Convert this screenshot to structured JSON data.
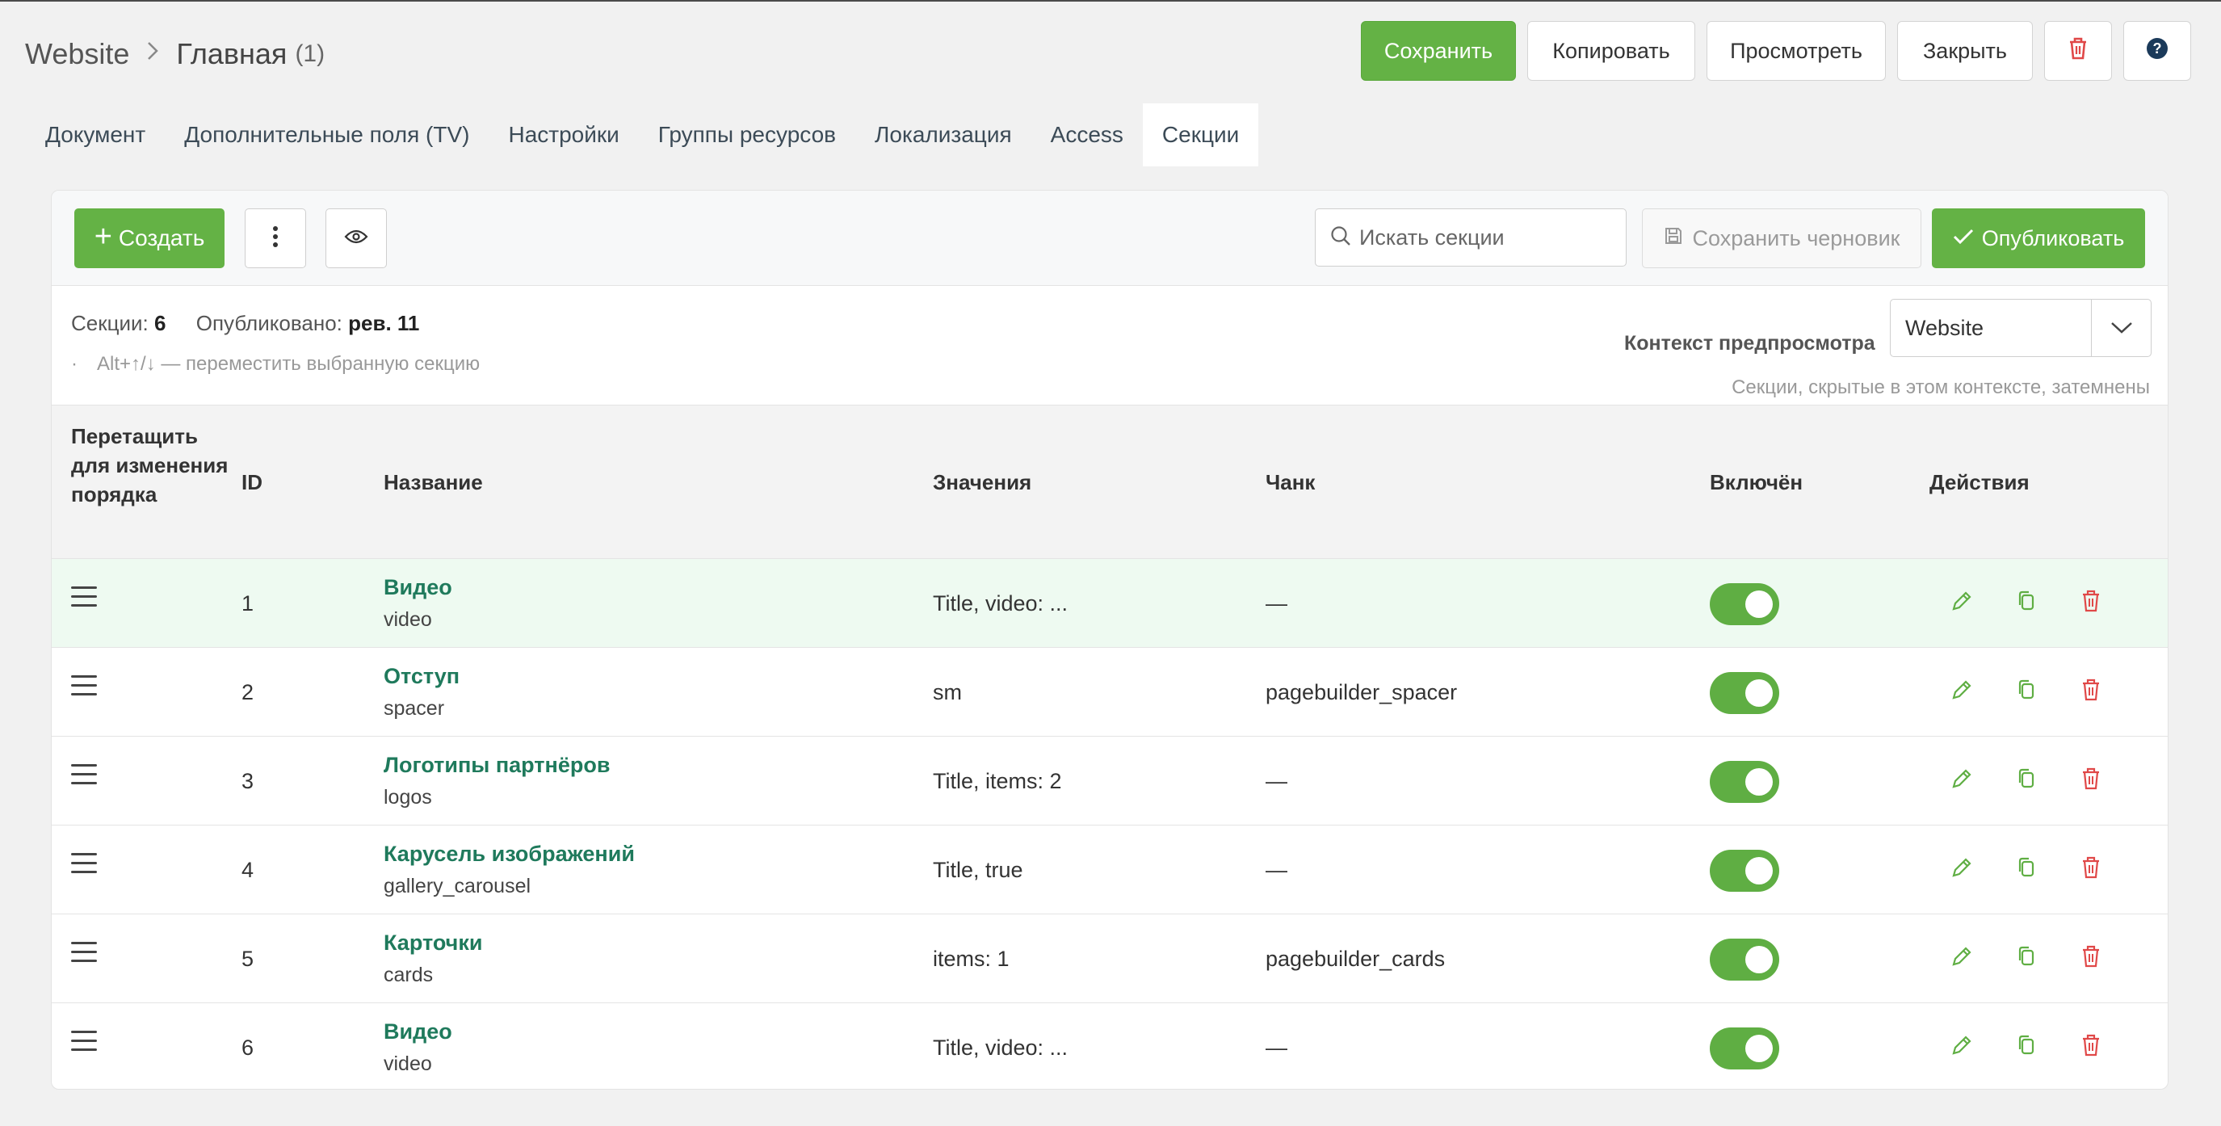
{
  "breadcrumb": {
    "root": "Website",
    "current": "Главная",
    "count": "(1)"
  },
  "top_actions": {
    "save": "Сохранить",
    "copy": "Копировать",
    "preview": "Просмотреть",
    "close": "Закрыть"
  },
  "tabs": [
    {
      "label": "Документ"
    },
    {
      "label": "Дополнительные поля (TV)"
    },
    {
      "label": "Настройки"
    },
    {
      "label": "Группы ресурсов"
    },
    {
      "label": "Локализация"
    },
    {
      "label": "Access"
    },
    {
      "label": "Секции",
      "active": true
    }
  ],
  "toolbar": {
    "create_label": "Создать",
    "search_placeholder": "Искать секции",
    "save_draft_label": "Сохранить черновик",
    "publish_label": "Опубликовать"
  },
  "info": {
    "sections_label": "Секции:",
    "sections_count": "6",
    "published_label": "Опубликовано:",
    "published_value": "рев. 11",
    "hint": "Alt+↑/↓ — переместить выбранную секцию",
    "context_label": "Контекст предпросмотра",
    "context_value": "Website",
    "context_note": "Секции, скрытые в этом контексте, затемнены"
  },
  "table": {
    "headers": {
      "drag": "Перетащить для изменения порядка",
      "id": "ID",
      "name": "Название",
      "values": "Значения",
      "chunk": "Чанк",
      "enabled": "Включён",
      "actions": "Действия"
    },
    "rows": [
      {
        "id": "1",
        "title": "Видео",
        "key": "video",
        "values": "Title, video: ...",
        "chunk": "—",
        "enabled": true
      },
      {
        "id": "2",
        "title": "Отступ",
        "key": "spacer",
        "values": "sm",
        "chunk": "pagebuilder_spacer",
        "enabled": true
      },
      {
        "id": "3",
        "title": "Логотипы партнёров",
        "key": "logos",
        "values": "Title, items: 2",
        "chunk": "—",
        "enabled": true
      },
      {
        "id": "4",
        "title": "Карусель изображений",
        "key": "gallery_carousel",
        "values": "Title, true",
        "chunk": "—",
        "enabled": true
      },
      {
        "id": "5",
        "title": "Карточки",
        "key": "cards",
        "values": "items: 1",
        "chunk": "pagebuilder_cards",
        "enabled": true
      },
      {
        "id": "6",
        "title": "Видео",
        "key": "video",
        "values": "Title, video: ...",
        "chunk": "—",
        "enabled": true
      }
    ]
  },
  "colors": {
    "accent_green": "#64b245",
    "link_green": "#1f7a5c",
    "danger_red": "#e04848",
    "highlight_row": "#eefaf1"
  },
  "icons": {
    "delete": "trash-icon",
    "help": "help-circle-icon",
    "more": "kebab-icon",
    "preview": "eye-icon",
    "search": "search-icon",
    "draft": "floppy-disk-icon",
    "publish": "check-icon",
    "edit": "pencil-icon",
    "duplicate": "copy-icon"
  }
}
